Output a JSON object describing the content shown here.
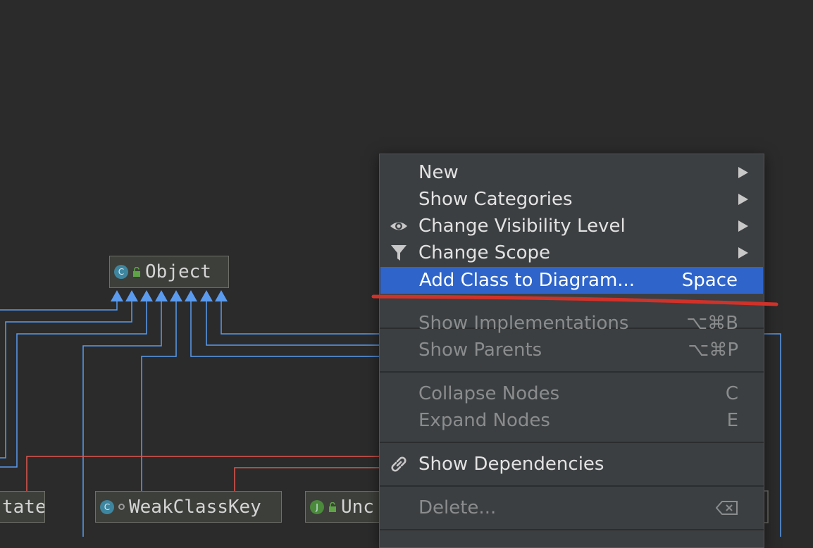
{
  "diagram": {
    "nodes": {
      "object": {
        "label": "Object",
        "icon": "class-icon",
        "icon_letter": "C"
      },
      "state": {
        "label": "tate"
      },
      "weak_class_key": {
        "label": "WeakClassKey",
        "icon": "class-icon",
        "icon_letter": "C"
      },
      "unc": {
        "label": "Unc",
        "icon": "java-class-icon",
        "icon_letter": "J"
      }
    },
    "colors": {
      "inheritance": "#5b9bef",
      "dependency": "#e0574f",
      "background": "#2b2b2b"
    }
  },
  "context_menu": {
    "items": [
      {
        "label": "New",
        "submenu": true
      },
      {
        "label": "Show Categories",
        "submenu": true
      },
      {
        "label": "Change Visibility Level",
        "submenu": true,
        "icon": "eye-icon"
      },
      {
        "label": "Change Scope",
        "submenu": true,
        "icon": "filter-icon"
      },
      {
        "label": "Add Class to Diagram...",
        "shortcut": "Space",
        "selected": true
      },
      {
        "label": "Show Implementations",
        "shortcut": "⌥⌘B",
        "disabled": true
      },
      {
        "label": "Show Parents",
        "shortcut": "⌥⌘P",
        "disabled": true
      },
      {
        "label": "Collapse Nodes",
        "shortcut": "C",
        "disabled": true
      },
      {
        "label": "Expand Nodes",
        "shortcut": "E",
        "disabled": true
      },
      {
        "label": "Show Dependencies",
        "icon": "link-icon"
      },
      {
        "label": "Delete...",
        "disabled": true,
        "shortcut_icon": "delete-key-icon"
      }
    ],
    "colors": {
      "background": "#3c3f41",
      "selection": "#2f65ca",
      "annotation_underline": "#d0322a"
    }
  }
}
